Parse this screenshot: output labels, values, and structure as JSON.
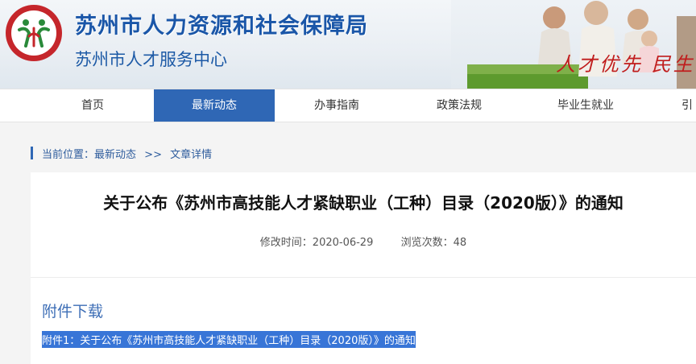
{
  "header": {
    "title": "苏州市人力资源和社会保障局",
    "subtitle": "苏州市人才服务中心",
    "slogan": "人才优先 民生",
    "logo_icon": "logo-emblem-icon",
    "colors": {
      "title": "#1a56a8",
      "logo_ring": "#c5262b",
      "slogan": "#c01d1d"
    }
  },
  "nav": {
    "items": [
      {
        "label": "首页"
      },
      {
        "label": "最新动态"
      },
      {
        "label": "办事指南"
      },
      {
        "label": "政策法规"
      },
      {
        "label": "毕业生就业"
      },
      {
        "label": "引"
      }
    ],
    "active_index": 1,
    "active_color": "#2f67b5"
  },
  "breadcrumb": {
    "prefix": "当前位置：",
    "section": "最新动态",
    "separator": ">>",
    "current": "文章详情"
  },
  "article": {
    "title": "关于公布《苏州市高技能人才紧缺职业（工种）目录（2020版）》的通知",
    "modified_label": "修改时间：",
    "modified_date": "2020-06-29",
    "views_label": "浏览次数：",
    "views": "48"
  },
  "attachments": {
    "heading": "附件下载",
    "items": [
      {
        "label": "附件1：关于公布《苏州市高技能人才紧缺职业（工种）目录（2020版）》的通知"
      }
    ]
  }
}
